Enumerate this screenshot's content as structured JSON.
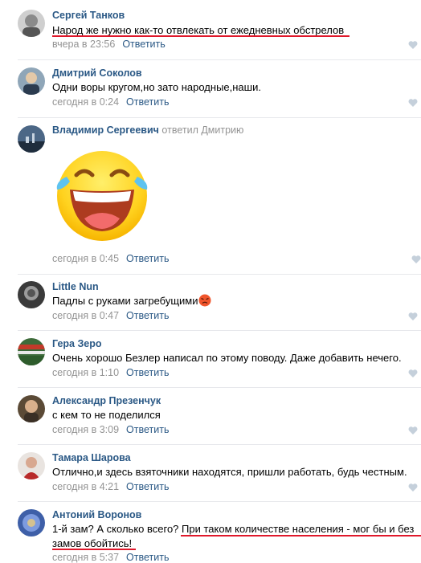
{
  "comments": [
    {
      "author": "Сергей Танков",
      "text": "Народ же нужно как-то отвлекать от ежедневных обстрелов",
      "time": "вчера в 23:56",
      "reply": "Ответить"
    },
    {
      "author": "Дмитрий Соколов",
      "text": "Одни воры кругом,но зато народные,наши.",
      "time": "сегодня в 0:24",
      "reply": "Ответить"
    },
    {
      "author": "Владимир Сергеевич",
      "reply_to": "ответил Дмитрию",
      "sticker": "laughing-crying-emoji",
      "time": "сегодня в 0:45",
      "reply": "Ответить"
    },
    {
      "author": "Little Nun",
      "text": "Падлы с руками загребущими",
      "emoji": "angry-face-emoji",
      "time": "сегодня в 0:47",
      "reply": "Ответить"
    },
    {
      "author": "Гера Зеро",
      "text": "Очень хорошо Безлер написал по этому поводу. Даже добавить нечего.",
      "time": "сегодня в 1:10",
      "reply": "Ответить"
    },
    {
      "author": "Александр Презенчук",
      "text": "с кем то не поделился",
      "time": "сегодня в 3:09",
      "reply": "Ответить"
    },
    {
      "author": "Тамара Шарова",
      "text": "Отлично,и здесь взяточники находятся, пришли работать, будь честным.",
      "time": "сегодня в 4:21",
      "reply": "Ответить"
    },
    {
      "author": "Антоний Воронов",
      "text_line1": "1-й зам? А сколько всего? При таком количестве населения - мог бы и без",
      "text_line2": "замов обойтись!",
      "time": "сегодня в 5:37",
      "reply": "Ответить"
    }
  ],
  "colors": {
    "link": "#2a5885",
    "meta": "#939393",
    "underline": "#e0182b",
    "divider": "#e7e8ec"
  },
  "icons": {
    "like": "heart-icon"
  }
}
